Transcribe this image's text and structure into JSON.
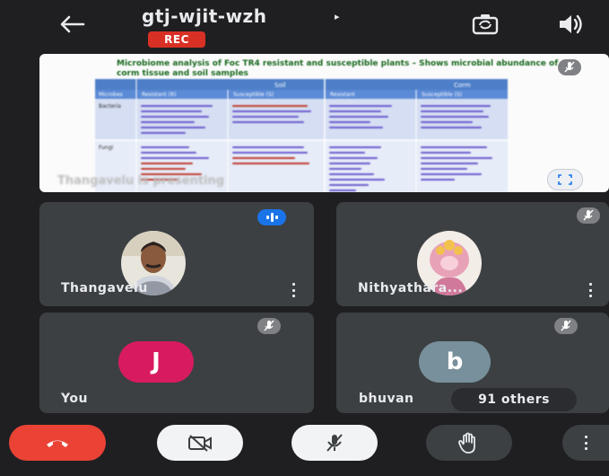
{
  "meeting": {
    "code": "gtj-wjit-wzh",
    "caret": "▸",
    "rec_label": "REC"
  },
  "presentation": {
    "slide_title": "Microbiome analysis of Foc TR4 resistant and susceptible plants – Shows microbial abundance of corm tissue and soil samples",
    "table": {
      "header_groups": [
        "Soil",
        "Corm"
      ],
      "columns": [
        "Microbes",
        "Resistant (R)",
        "Susceptible (S)",
        "Resistant",
        "Susceptible (S)"
      ],
      "row_labels": [
        "Bacteria",
        "Fungi"
      ]
    },
    "presenter_label": "Thangavelu is presenting"
  },
  "participants": [
    {
      "name": "Thangavelu",
      "avatar": "photo-man",
      "speaking": true
    },
    {
      "name": "Nithyathara...",
      "avatar": "photo-deity",
      "muted": true
    },
    {
      "name": "You",
      "initial": "J",
      "color": "#d81b60",
      "muted": true
    },
    {
      "name": "bhuvan",
      "initial": "b",
      "color": "#78909c",
      "muted": true
    }
  ],
  "others_label": "91 others",
  "icons": {
    "back": "arrow-left-icon",
    "switch_camera": "camera-switch-icon",
    "speaker": "speaker-icon",
    "mic_off": "mic-off-icon",
    "fullscreen": "fullscreen-icon",
    "more": "more-vert-icon",
    "end_call": "phone-hangup-icon",
    "video_off": "video-off-icon",
    "raise_hand": "hand-icon"
  },
  "colors": {
    "end_call": "#ea4335",
    "rec": "#d93025",
    "speaking": "#1a73e8"
  }
}
